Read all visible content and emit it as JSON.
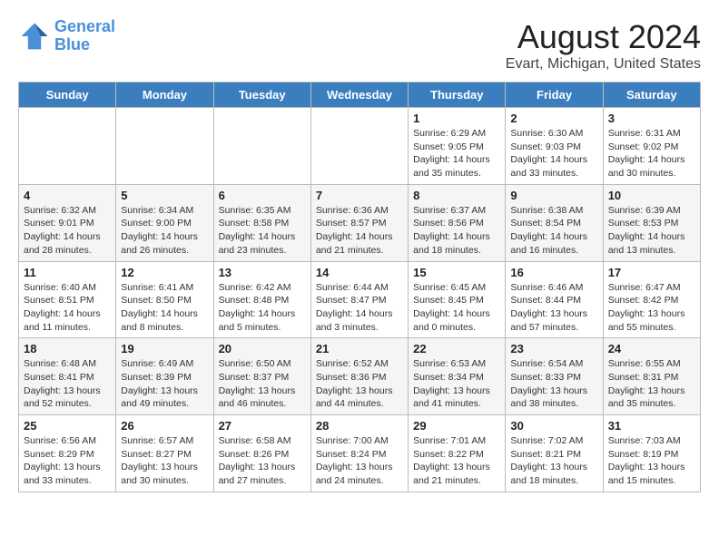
{
  "header": {
    "logo_line1": "General",
    "logo_line2": "Blue",
    "main_title": "August 2024",
    "subtitle": "Evart, Michigan, United States"
  },
  "weekdays": [
    "Sunday",
    "Monday",
    "Tuesday",
    "Wednesday",
    "Thursday",
    "Friday",
    "Saturday"
  ],
  "weeks": [
    [
      {
        "day": "",
        "info": ""
      },
      {
        "day": "",
        "info": ""
      },
      {
        "day": "",
        "info": ""
      },
      {
        "day": "",
        "info": ""
      },
      {
        "day": "1",
        "info": "Sunrise: 6:29 AM\nSunset: 9:05 PM\nDaylight: 14 hours\nand 35 minutes."
      },
      {
        "day": "2",
        "info": "Sunrise: 6:30 AM\nSunset: 9:03 PM\nDaylight: 14 hours\nand 33 minutes."
      },
      {
        "day": "3",
        "info": "Sunrise: 6:31 AM\nSunset: 9:02 PM\nDaylight: 14 hours\nand 30 minutes."
      }
    ],
    [
      {
        "day": "4",
        "info": "Sunrise: 6:32 AM\nSunset: 9:01 PM\nDaylight: 14 hours\nand 28 minutes."
      },
      {
        "day": "5",
        "info": "Sunrise: 6:34 AM\nSunset: 9:00 PM\nDaylight: 14 hours\nand 26 minutes."
      },
      {
        "day": "6",
        "info": "Sunrise: 6:35 AM\nSunset: 8:58 PM\nDaylight: 14 hours\nand 23 minutes."
      },
      {
        "day": "7",
        "info": "Sunrise: 6:36 AM\nSunset: 8:57 PM\nDaylight: 14 hours\nand 21 minutes."
      },
      {
        "day": "8",
        "info": "Sunrise: 6:37 AM\nSunset: 8:56 PM\nDaylight: 14 hours\nand 18 minutes."
      },
      {
        "day": "9",
        "info": "Sunrise: 6:38 AM\nSunset: 8:54 PM\nDaylight: 14 hours\nand 16 minutes."
      },
      {
        "day": "10",
        "info": "Sunrise: 6:39 AM\nSunset: 8:53 PM\nDaylight: 14 hours\nand 13 minutes."
      }
    ],
    [
      {
        "day": "11",
        "info": "Sunrise: 6:40 AM\nSunset: 8:51 PM\nDaylight: 14 hours\nand 11 minutes."
      },
      {
        "day": "12",
        "info": "Sunrise: 6:41 AM\nSunset: 8:50 PM\nDaylight: 14 hours\nand 8 minutes."
      },
      {
        "day": "13",
        "info": "Sunrise: 6:42 AM\nSunset: 8:48 PM\nDaylight: 14 hours\nand 5 minutes."
      },
      {
        "day": "14",
        "info": "Sunrise: 6:44 AM\nSunset: 8:47 PM\nDaylight: 14 hours\nand 3 minutes."
      },
      {
        "day": "15",
        "info": "Sunrise: 6:45 AM\nSunset: 8:45 PM\nDaylight: 14 hours\nand 0 minutes."
      },
      {
        "day": "16",
        "info": "Sunrise: 6:46 AM\nSunset: 8:44 PM\nDaylight: 13 hours\nand 57 minutes."
      },
      {
        "day": "17",
        "info": "Sunrise: 6:47 AM\nSunset: 8:42 PM\nDaylight: 13 hours\nand 55 minutes."
      }
    ],
    [
      {
        "day": "18",
        "info": "Sunrise: 6:48 AM\nSunset: 8:41 PM\nDaylight: 13 hours\nand 52 minutes."
      },
      {
        "day": "19",
        "info": "Sunrise: 6:49 AM\nSunset: 8:39 PM\nDaylight: 13 hours\nand 49 minutes."
      },
      {
        "day": "20",
        "info": "Sunrise: 6:50 AM\nSunset: 8:37 PM\nDaylight: 13 hours\nand 46 minutes."
      },
      {
        "day": "21",
        "info": "Sunrise: 6:52 AM\nSunset: 8:36 PM\nDaylight: 13 hours\nand 44 minutes."
      },
      {
        "day": "22",
        "info": "Sunrise: 6:53 AM\nSunset: 8:34 PM\nDaylight: 13 hours\nand 41 minutes."
      },
      {
        "day": "23",
        "info": "Sunrise: 6:54 AM\nSunset: 8:33 PM\nDaylight: 13 hours\nand 38 minutes."
      },
      {
        "day": "24",
        "info": "Sunrise: 6:55 AM\nSunset: 8:31 PM\nDaylight: 13 hours\nand 35 minutes."
      }
    ],
    [
      {
        "day": "25",
        "info": "Sunrise: 6:56 AM\nSunset: 8:29 PM\nDaylight: 13 hours\nand 33 minutes."
      },
      {
        "day": "26",
        "info": "Sunrise: 6:57 AM\nSunset: 8:27 PM\nDaylight: 13 hours\nand 30 minutes."
      },
      {
        "day": "27",
        "info": "Sunrise: 6:58 AM\nSunset: 8:26 PM\nDaylight: 13 hours\nand 27 minutes."
      },
      {
        "day": "28",
        "info": "Sunrise: 7:00 AM\nSunset: 8:24 PM\nDaylight: 13 hours\nand 24 minutes."
      },
      {
        "day": "29",
        "info": "Sunrise: 7:01 AM\nSunset: 8:22 PM\nDaylight: 13 hours\nand 21 minutes."
      },
      {
        "day": "30",
        "info": "Sunrise: 7:02 AM\nSunset: 8:21 PM\nDaylight: 13 hours\nand 18 minutes."
      },
      {
        "day": "31",
        "info": "Sunrise: 7:03 AM\nSunset: 8:19 PM\nDaylight: 13 hours\nand 15 minutes."
      }
    ]
  ]
}
